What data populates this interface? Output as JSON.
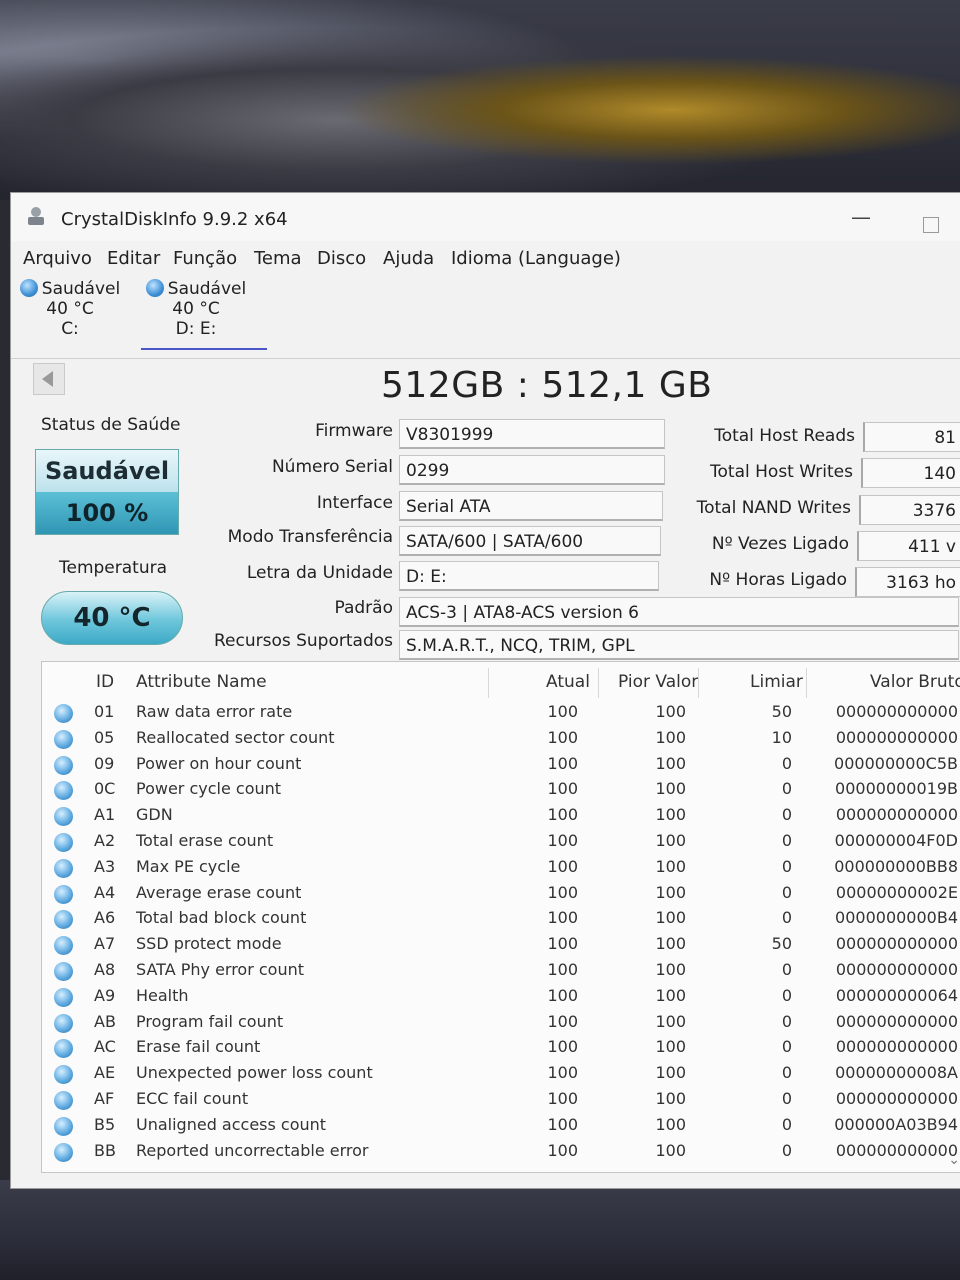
{
  "window": {
    "title": "CrystalDiskInfo 9.9.2 x64"
  },
  "menu": [
    "Arquivo",
    "Editar",
    "Função",
    "Tema",
    "Disco",
    "Ajuda",
    "Idioma (Language)"
  ],
  "disks": [
    {
      "status": "Saudável",
      "temp": "40 °C",
      "letter": "C:"
    },
    {
      "status": "Saudável",
      "temp": "40 °C",
      "letter": "D: E:"
    }
  ],
  "disk_title": "512GB : 512,1 GB",
  "health": {
    "label": "Status de Saúde",
    "status": "Saudável",
    "percent": "100 %"
  },
  "temperature": {
    "label": "Temperatura",
    "value": "40 °C"
  },
  "fields": [
    {
      "label": "Firmware",
      "value": "V8301999"
    },
    {
      "label": "Número Serial",
      "value": "0299"
    },
    {
      "label": "Interface",
      "value": "Serial ATA"
    },
    {
      "label": "Modo Transferência",
      "value": "SATA/600 | SATA/600"
    },
    {
      "label": "Letra da Unidade",
      "value": "D: E:"
    },
    {
      "label": "Padrão",
      "value": "ACS-3 | ATA8-ACS version 6"
    },
    {
      "label": "Recursos Suportados",
      "value": "S.M.A.R.T., NCQ, TRIM, GPL"
    }
  ],
  "stats": [
    {
      "label": "Total Host Reads",
      "value": "81"
    },
    {
      "label": "Total Host Writes",
      "value": "140"
    },
    {
      "label": "Total NAND Writes",
      "value": "3376"
    },
    {
      "label": "Nº Vezes Ligado",
      "value": "411 v"
    },
    {
      "label": "Nº Horas Ligado",
      "value": "3163 ho"
    }
  ],
  "table": {
    "headers": {
      "id": "ID",
      "name": "Attribute Name",
      "current": "Atual",
      "worst": "Pior Valor",
      "threshold": "Limiar",
      "raw": "Valor Bruto"
    },
    "rows": [
      {
        "id": "01",
        "name": "Raw data error rate",
        "current": "100",
        "worst": "100",
        "threshold": "50",
        "raw": "000000000000"
      },
      {
        "id": "05",
        "name": "Reallocated sector count",
        "current": "100",
        "worst": "100",
        "threshold": "10",
        "raw": "000000000000"
      },
      {
        "id": "09",
        "name": "Power on hour count",
        "current": "100",
        "worst": "100",
        "threshold": "0",
        "raw": "000000000C5B"
      },
      {
        "id": "0C",
        "name": "Power cycle count",
        "current": "100",
        "worst": "100",
        "threshold": "0",
        "raw": "00000000019B"
      },
      {
        "id": "A1",
        "name": "GDN",
        "current": "100",
        "worst": "100",
        "threshold": "0",
        "raw": "000000000000"
      },
      {
        "id": "A2",
        "name": "Total erase count",
        "current": "100",
        "worst": "100",
        "threshold": "0",
        "raw": "000000004F0D"
      },
      {
        "id": "A3",
        "name": "Max PE cycle",
        "current": "100",
        "worst": "100",
        "threshold": "0",
        "raw": "000000000BB8"
      },
      {
        "id": "A4",
        "name": "Average erase count",
        "current": "100",
        "worst": "100",
        "threshold": "0",
        "raw": "00000000002E"
      },
      {
        "id": "A6",
        "name": "Total bad block count",
        "current": "100",
        "worst": "100",
        "threshold": "0",
        "raw": "0000000000B4"
      },
      {
        "id": "A7",
        "name": "SSD protect mode",
        "current": "100",
        "worst": "100",
        "threshold": "50",
        "raw": "000000000000"
      },
      {
        "id": "A8",
        "name": "SATA Phy error count",
        "current": "100",
        "worst": "100",
        "threshold": "0",
        "raw": "000000000000"
      },
      {
        "id": "A9",
        "name": "Health",
        "current": "100",
        "worst": "100",
        "threshold": "0",
        "raw": "000000000064"
      },
      {
        "id": "AB",
        "name": "Program fail count",
        "current": "100",
        "worst": "100",
        "threshold": "0",
        "raw": "000000000000"
      },
      {
        "id": "AC",
        "name": "Erase fail count",
        "current": "100",
        "worst": "100",
        "threshold": "0",
        "raw": "000000000000"
      },
      {
        "id": "AE",
        "name": "Unexpected power loss count",
        "current": "100",
        "worst": "100",
        "threshold": "0",
        "raw": "00000000008A"
      },
      {
        "id": "AF",
        "name": "ECC fail count",
        "current": "100",
        "worst": "100",
        "threshold": "0",
        "raw": "000000000000"
      },
      {
        "id": "B5",
        "name": "Unaligned access count",
        "current": "100",
        "worst": "100",
        "threshold": "0",
        "raw": "000000A03B94"
      },
      {
        "id": "BB",
        "name": "Reported uncorrectable error",
        "current": "100",
        "worst": "100",
        "threshold": "0",
        "raw": "000000000000"
      }
    ]
  }
}
